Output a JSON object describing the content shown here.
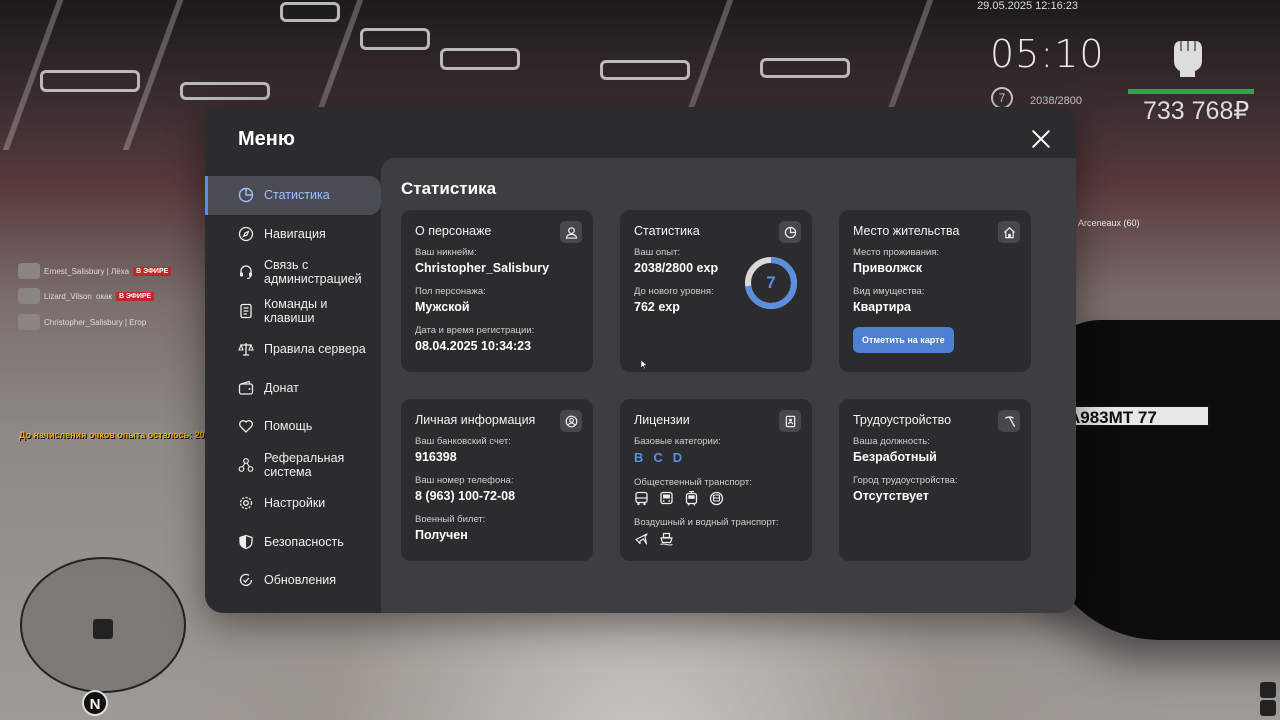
{
  "hud": {
    "datetime": "29.05.2025 12:16:23",
    "time": "05:10",
    "level": "7",
    "exp": "2038/2800",
    "money": "733 768₽",
    "player_tag": "Arceneaux (60)",
    "exp_notice": "До начисления очков опыта осталось: 20 мин. 59 сек.",
    "minimap_north": "N",
    "plate": "А983МТ 77"
  },
  "chat": [
    {
      "name": "Ernest_Salisbury | Лёха",
      "badge": "В ЭФИРЕ"
    },
    {
      "name": "Lizard_Vilson",
      "extra": "окак",
      "badge": "В ЭФИРЕ"
    },
    {
      "name": "Christopher_Salisbury | Егор"
    }
  ],
  "menu": {
    "title": "Меню",
    "nav": [
      {
        "label": "Статистика",
        "icon": "stats-icon",
        "active": true
      },
      {
        "label": "Навигация",
        "icon": "compass-icon"
      },
      {
        "label": "Связь с администрацией",
        "icon": "headset-icon"
      },
      {
        "label": "Команды и клавиши",
        "icon": "document-icon"
      },
      {
        "label": "Правила сервера",
        "icon": "scales-icon"
      },
      {
        "label": "Донат",
        "icon": "wallet-icon"
      },
      {
        "label": "Помощь",
        "icon": "heart-icon"
      },
      {
        "label": "Реферальная система",
        "icon": "network-icon"
      },
      {
        "label": "Настройки",
        "icon": "gear-icon"
      },
      {
        "label": "Безопасность",
        "icon": "shield-icon"
      },
      {
        "label": "Обновления",
        "icon": "refresh-check-icon"
      }
    ],
    "content_title": "Статистика",
    "cards": {
      "character": {
        "title": "О персонаже",
        "icon": "user-icon",
        "nickname_label": "Ваш никнейм:",
        "nickname": "Christopher_Salisbury",
        "gender_label": "Пол персонажа:",
        "gender": "Мужской",
        "reg_label": "Дата и время регистрации:",
        "reg": "08.04.2025 10:34:23"
      },
      "stats": {
        "title": "Статистика",
        "icon": "pie-icon",
        "exp_label": "Ваш опыт:",
        "exp": "2038/2800 exp",
        "next_label": "До нового уровня:",
        "next": "762 exp",
        "level": "7",
        "progress": 0.728
      },
      "residence": {
        "title": "Место жительства",
        "icon": "home-icon",
        "place_label": "Место проживания:",
        "place": "Приволжск",
        "type_label": "Вид имущества:",
        "type": "Квартира",
        "button": "Отметить на карте"
      },
      "personal": {
        "title": "Личная информация",
        "icon": "user-circle-icon",
        "bank_label": "Ваш банковский счет:",
        "bank": "916398",
        "phone_label": "Ваш номер телефона:",
        "phone": "8 (963) 100-72-08",
        "military_label": "Военный билет:",
        "military": "Получен"
      },
      "licenses": {
        "title": "Лицензии",
        "icon": "license-icon",
        "base_label": "Базовые категории:",
        "categories": [
          "B",
          "C",
          "D"
        ],
        "public_label": "Общественный транспорт:",
        "public_icons": [
          "bus-icon",
          "bus-front-icon",
          "tram-icon",
          "trolleybus-icon"
        ],
        "air_label": "Воздушный и водный транспорт:",
        "air_icons": [
          "plane-icon",
          "ship-icon"
        ]
      },
      "employment": {
        "title": "Трудоустройство",
        "icon": "pickaxe-icon",
        "position_label": "Ваша должность:",
        "position": "Безработный",
        "city_label": "Город трудоустройства:",
        "city": "Отсутствует"
      }
    }
  },
  "colors": {
    "accent": "#5b8de0",
    "panel": "#2c2b2d",
    "content": "#3e3e40",
    "card": "#2c2c2e",
    "button": "#4e7fd3"
  }
}
